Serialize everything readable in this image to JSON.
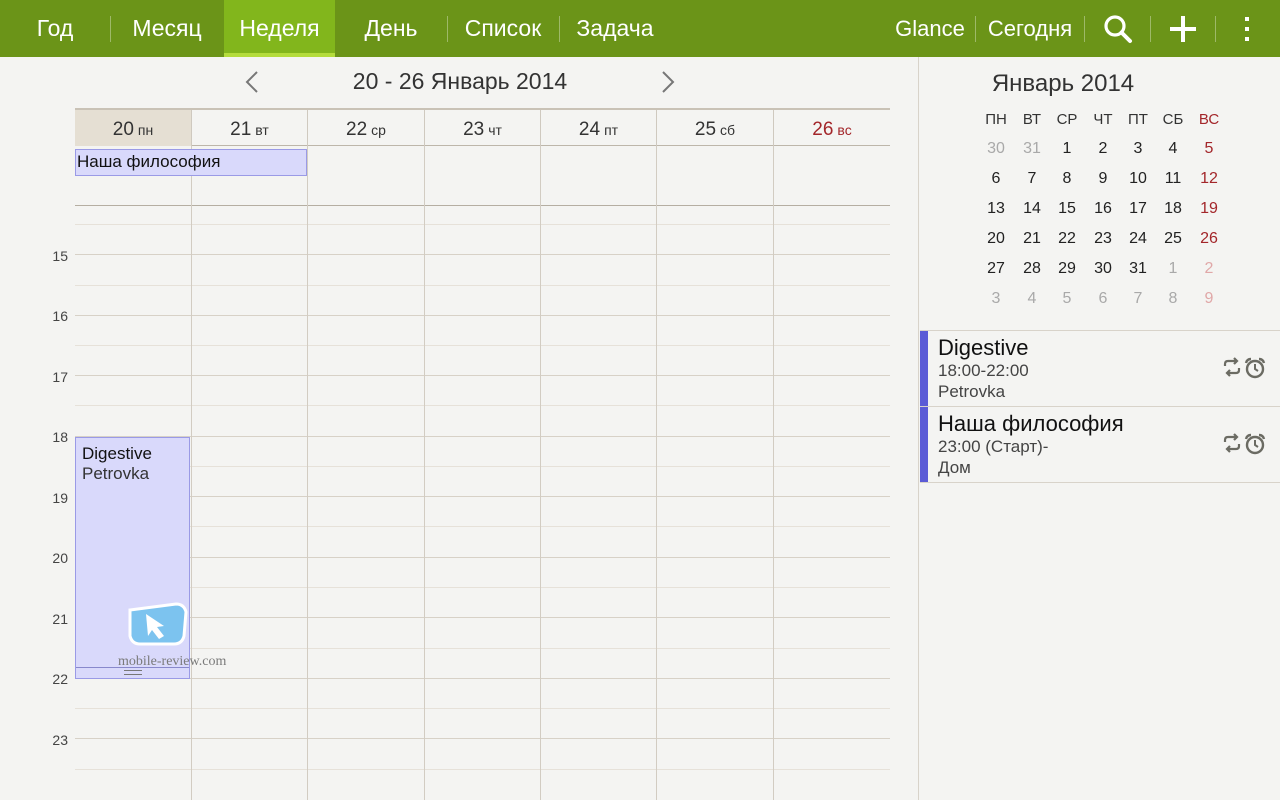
{
  "topbar": {
    "tabs": [
      {
        "label": "Год"
      },
      {
        "label": "Месяц"
      },
      {
        "label": "Неделя"
      },
      {
        "label": "День"
      },
      {
        "label": "Список"
      },
      {
        "label": "Задача"
      }
    ],
    "active_tab": "Неделя",
    "glance_label": "Glance",
    "today_label": "Сегодня",
    "icons": [
      "search-icon",
      "add-icon",
      "overflow-menu-icon"
    ],
    "bar_color": "#6b9418",
    "active_color": "#82b61c"
  },
  "week": {
    "title": "20 - 26 Январь 2014",
    "days": [
      {
        "num": "20",
        "wd": "пн"
      },
      {
        "num": "21",
        "wd": "вт"
      },
      {
        "num": "22",
        "wd": "ср"
      },
      {
        "num": "23",
        "wd": "чт"
      },
      {
        "num": "24",
        "wd": "пт"
      },
      {
        "num": "25",
        "wd": "сб"
      },
      {
        "num": "26",
        "wd": "вс"
      }
    ],
    "hours": [
      "15",
      "16",
      "17",
      "18",
      "19",
      "20",
      "21",
      "22",
      "23"
    ],
    "allday_event": {
      "title": "Наша философия"
    },
    "timed_event": {
      "title": "Digestive",
      "location": "Petrovka"
    }
  },
  "watermark": {
    "text": "mobile-review.com"
  },
  "mini_calendar": {
    "title": "Январь 2014",
    "weekdays": [
      "ПН",
      "ВТ",
      "СР",
      "ЧТ",
      "ПТ",
      "СБ",
      "ВС"
    ],
    "weeks": [
      [
        "30",
        "31",
        "1",
        "2",
        "3",
        "4",
        "5"
      ],
      [
        "6",
        "7",
        "8",
        "9",
        "10",
        "11",
        "12"
      ],
      [
        "13",
        "14",
        "15",
        "16",
        "17",
        "18",
        "19"
      ],
      [
        "20",
        "21",
        "22",
        "23",
        "24",
        "25",
        "26"
      ],
      [
        "27",
        "28",
        "29",
        "30",
        "31",
        "1",
        "2"
      ],
      [
        "3",
        "4",
        "5",
        "6",
        "7",
        "8",
        "9"
      ]
    ]
  },
  "agenda": [
    {
      "title": "Digestive",
      "time": "18:00-22:00",
      "location": "Petrovka",
      "icons": [
        "repeat-icon",
        "alarm-icon"
      ]
    },
    {
      "title": "Наша философия",
      "time": "23:00 (Старт)-",
      "location": "Дом",
      "icons": [
        "repeat-icon",
        "alarm-icon"
      ]
    }
  ],
  "colors": {
    "event_fill": "#d9d9fb",
    "agenda_bar": "#5b5bd6",
    "sunday": "#a3262a"
  }
}
